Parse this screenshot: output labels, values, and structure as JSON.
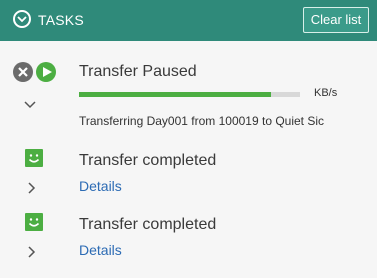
{
  "header": {
    "title": "TASKS",
    "clear_label": "Clear list"
  },
  "tasks": [
    {
      "title": "Transfer Paused",
      "progress": 0.87,
      "speed": "KB/s",
      "detail": "Transferring Day001 from 100019 to Quiet Sic"
    },
    {
      "title": "Transfer completed",
      "details_label": "Details"
    },
    {
      "title": "Transfer completed",
      "details_label": "Details"
    }
  ],
  "icons": {
    "collapse": "chevron-down-circle-icon",
    "cancel": "close-circle-icon",
    "resume": "play-circle-icon",
    "expand": "chevron-icon",
    "success": "smiley-icon"
  },
  "colors": {
    "header_bg": "#2f8a7a",
    "progress": "#4cae42",
    "link": "#2c6bb4"
  }
}
